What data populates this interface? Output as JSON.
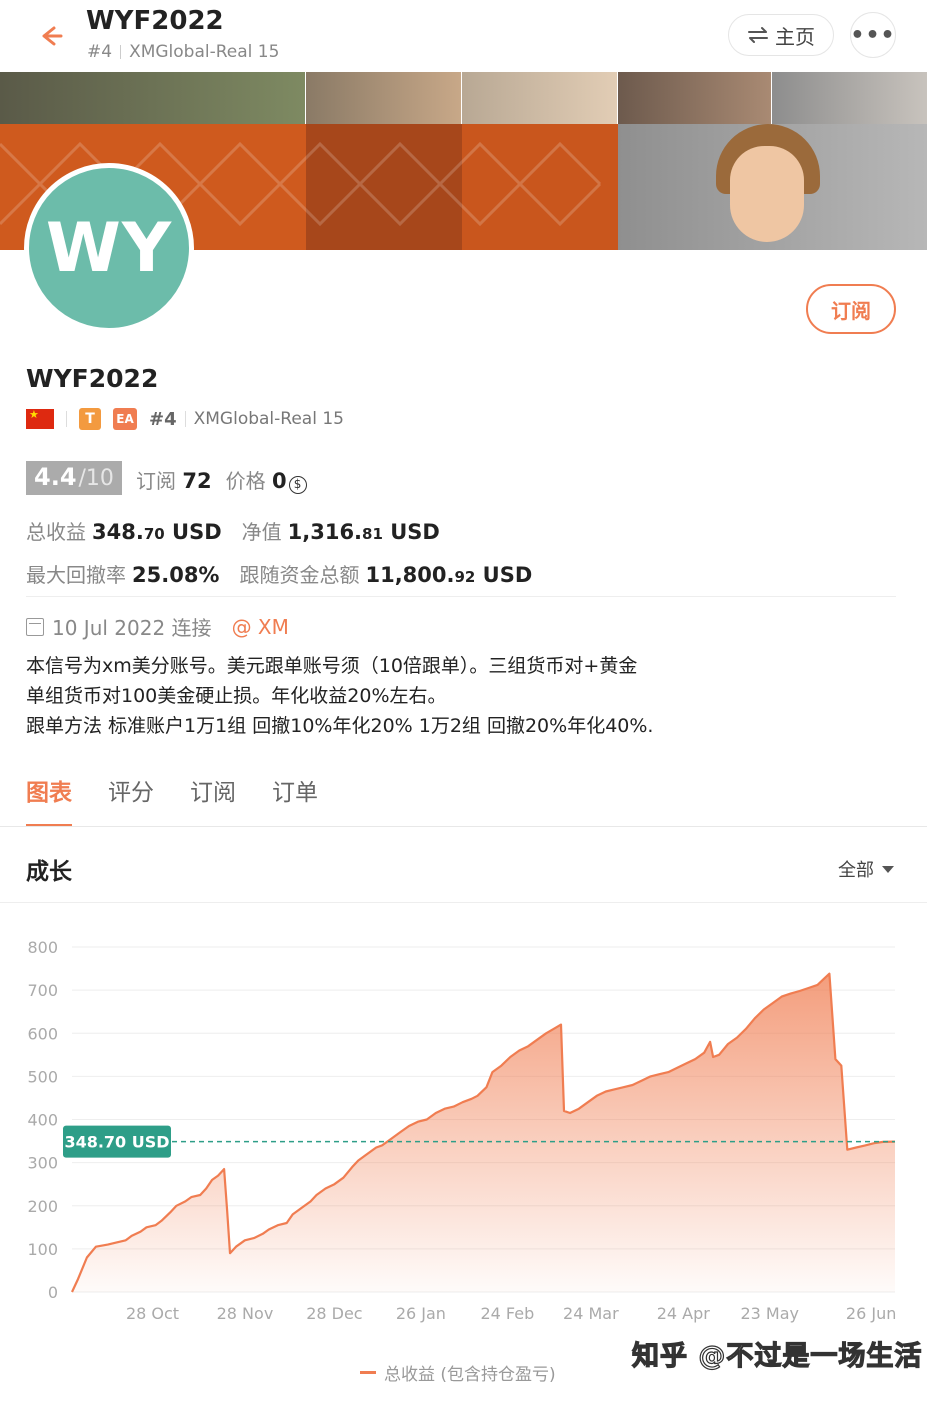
{
  "header": {
    "title": "WYF2022",
    "rank": "#4",
    "server": "XMGlobal-Real 15",
    "home_label": "主页",
    "more_label": "•••"
  },
  "profile": {
    "avatar_initials": "WY",
    "name": "WYF2022",
    "subscribe_label": "订阅",
    "tag_t": "T",
    "tag_ea": "EA",
    "rank": "#4",
    "server": "XMGlobal-Real 15"
  },
  "stats": {
    "score": "4.4",
    "score_max": "/10",
    "subs_label": "订阅",
    "subs_value": "72",
    "price_label": "价格",
    "price_value": "0",
    "total_profit_label": "总收益",
    "total_profit_int": "348.",
    "total_profit_dec": "70",
    "total_profit_unit": "USD",
    "equity_label": "净值",
    "equity_int": "1,316.",
    "equity_dec": "81",
    "equity_unit": "USD",
    "max_dd_label": "最大回撤率",
    "max_dd_value": "25.08%",
    "follow_funds_label": "跟随资金总额",
    "follow_funds_int": "11,800.",
    "follow_funds_dec": "92",
    "follow_funds_unit": "USD"
  },
  "connection": {
    "date": "10 Jul 2022 连接",
    "broker": "@ XM"
  },
  "description": [
    "本信号为xm美分账号。美元跟单账号须（10倍跟单）。三组货币对+黄金",
    "单组货币对100美金硬止损。年化收益20%左右。",
    "跟单方法 标准账户1万1组 回撤10%年化20%  1万2组 回撤20%年化40%."
  ],
  "tabs": [
    "图表",
    "评分",
    "订阅",
    "订单"
  ],
  "growth": {
    "title": "成长",
    "range_label": "全部",
    "legend": "总收益 (包含持仓盈亏)"
  },
  "watermark": "知乎 @不过是一场生活",
  "chart_data": {
    "type": "area",
    "series": [
      {
        "name": "总收益 (包含持仓盈亏)",
        "color": "#f07d51",
        "points": [
          [
            0,
            0
          ],
          [
            2,
            30
          ],
          [
            5,
            80
          ],
          [
            8,
            105
          ],
          [
            12,
            110
          ],
          [
            15,
            115
          ],
          [
            18,
            120
          ],
          [
            20,
            130
          ],
          [
            23,
            140
          ],
          [
            25,
            150
          ],
          [
            28,
            155
          ],
          [
            30,
            165
          ],
          [
            33,
            185
          ],
          [
            35,
            200
          ],
          [
            38,
            210
          ],
          [
            40,
            220
          ],
          [
            43,
            225
          ],
          [
            45,
            240
          ],
          [
            47,
            260
          ],
          [
            49,
            270
          ],
          [
            51,
            285
          ],
          [
            52,
            190
          ],
          [
            53,
            90
          ],
          [
            55,
            105
          ],
          [
            58,
            120
          ],
          [
            61,
            125
          ],
          [
            64,
            135
          ],
          [
            66,
            145
          ],
          [
            69,
            155
          ],
          [
            72,
            160
          ],
          [
            74,
            180
          ],
          [
            77,
            195
          ],
          [
            80,
            210
          ],
          [
            82,
            225
          ],
          [
            85,
            240
          ],
          [
            88,
            250
          ],
          [
            91,
            265
          ],
          [
            94,
            290
          ],
          [
            96,
            305
          ],
          [
            99,
            320
          ],
          [
            102,
            335
          ],
          [
            104,
            340
          ],
          [
            107,
            355
          ],
          [
            110,
            370
          ],
          [
            113,
            385
          ],
          [
            116,
            395
          ],
          [
            119,
            400
          ],
          [
            122,
            415
          ],
          [
            125,
            425
          ],
          [
            128,
            430
          ],
          [
            131,
            440
          ],
          [
            134,
            448
          ],
          [
            136,
            455
          ],
          [
            139,
            475
          ],
          [
            141,
            510
          ],
          [
            144,
            525
          ],
          [
            147,
            545
          ],
          [
            150,
            560
          ],
          [
            153,
            570
          ],
          [
            156,
            585
          ],
          [
            159,
            600
          ],
          [
            162,
            612
          ],
          [
            164,
            620
          ],
          [
            165,
            420
          ],
          [
            167,
            415
          ],
          [
            170,
            425
          ],
          [
            173,
            440
          ],
          [
            176,
            455
          ],
          [
            179,
            465
          ],
          [
            182,
            470
          ],
          [
            185,
            475
          ],
          [
            188,
            480
          ],
          [
            191,
            490
          ],
          [
            194,
            500
          ],
          [
            197,
            505
          ],
          [
            200,
            510
          ],
          [
            203,
            520
          ],
          [
            206,
            530
          ],
          [
            209,
            540
          ],
          [
            212,
            555
          ],
          [
            214,
            580
          ],
          [
            215,
            545
          ],
          [
            217,
            550
          ],
          [
            220,
            575
          ],
          [
            223,
            590
          ],
          [
            226,
            610
          ],
          [
            229,
            635
          ],
          [
            232,
            655
          ],
          [
            235,
            670
          ],
          [
            238,
            685
          ],
          [
            241,
            692
          ],
          [
            244,
            698
          ],
          [
            247,
            705
          ],
          [
            250,
            712
          ],
          [
            252,
            725
          ],
          [
            254,
            738
          ],
          [
            256,
            540
          ],
          [
            258,
            525
          ],
          [
            260,
            330
          ],
          [
            263,
            335
          ],
          [
            266,
            340
          ],
          [
            269,
            345
          ],
          [
            272,
            348
          ],
          [
            276,
            348.7
          ]
        ]
      }
    ],
    "current_value_label": "348.70 USD",
    "current_value": 348.7,
    "y_ticks": [
      0,
      100,
      200,
      300,
      400,
      500,
      600,
      700,
      800
    ],
    "ylim": [
      0,
      800
    ],
    "x_ticks": [
      "28 Oct",
      "28 Nov",
      "28 Dec",
      "26 Jan",
      "24 Feb",
      "24 Mar",
      "24 Apr",
      "23 May",
      "26 Jun"
    ],
    "x_tick_days": [
      27,
      58,
      88,
      117,
      146,
      174,
      205,
      234,
      268
    ],
    "xlim": [
      0,
      276
    ],
    "grid": true,
    "legend_position": "bottom-center"
  }
}
